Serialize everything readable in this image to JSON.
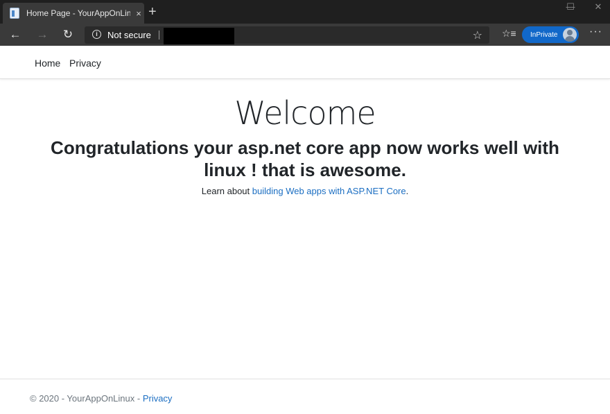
{
  "browser": {
    "tab": {
      "title": "Home Page - YourAppOnLinux",
      "close_icon": "×"
    },
    "new_tab_icon": "+",
    "window_controls": {
      "minimize": "—",
      "maximize": "☐",
      "close": "✕"
    },
    "nav": {
      "back": "←",
      "forward": "→",
      "refresh": "↻"
    },
    "address": {
      "security_label": "Not secure",
      "url_redacted": true
    },
    "favorite_icon": "☆",
    "favorites_icon": "☆≡",
    "inprivate_label": "InPrivate",
    "more_icon": "···"
  },
  "site": {
    "nav": {
      "home": "Home",
      "privacy": "Privacy"
    },
    "main": {
      "heading": "Welcome",
      "message": "Congratulations your asp.net core app now works well with linux ! that is awesome.",
      "learn_prefix": "Learn about ",
      "learn_link": "building Web apps with ASP.NET Core",
      "learn_suffix": "."
    },
    "footer": {
      "copyright": "© 2020 - YourAppOnLinux - ",
      "privacy_link": "Privacy"
    }
  },
  "colors": {
    "link": "#1b6ec2",
    "inprivate": "#1168c9",
    "text": "#212529"
  }
}
